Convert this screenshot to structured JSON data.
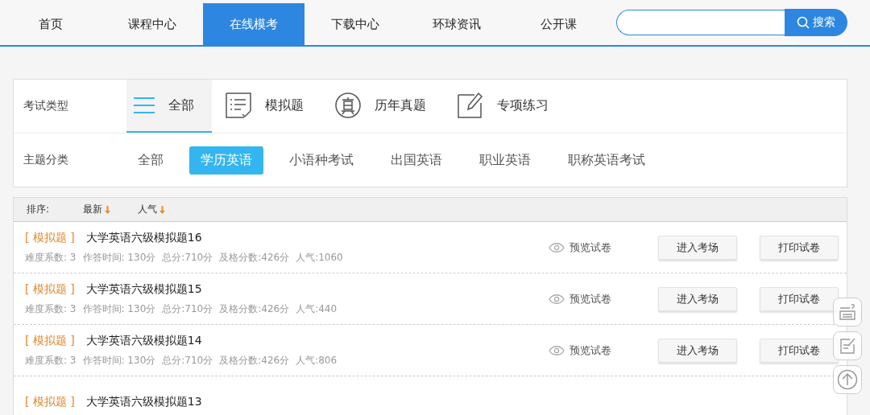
{
  "nav": {
    "items": [
      {
        "label": "首页",
        "selected": false
      },
      {
        "label": "课程中心",
        "selected": false
      },
      {
        "label": "在线模考",
        "selected": true
      },
      {
        "label": "下载中心",
        "selected": false
      },
      {
        "label": "环球资讯",
        "selected": false
      },
      {
        "label": "公开课",
        "selected": false
      }
    ],
    "search": {
      "button": "搜索"
    }
  },
  "exam_types": {
    "label": "考试类型",
    "items": [
      {
        "kind": "all",
        "label": "全部",
        "selected": true
      },
      {
        "kind": "mock",
        "label": "模拟题",
        "selected": false
      },
      {
        "kind": "past",
        "label": "历年真题",
        "selected": false
      },
      {
        "kind": "practice",
        "label": "专项练习",
        "selected": false
      }
    ]
  },
  "topics": {
    "label": "主题分类",
    "items": [
      {
        "label": "全部",
        "selected": false
      },
      {
        "label": "学历英语",
        "selected": true
      },
      {
        "label": "小语种考试",
        "selected": false
      },
      {
        "label": "出国英语",
        "selected": false
      },
      {
        "label": "职业英语",
        "selected": false
      },
      {
        "label": "职称英语考试",
        "selected": false
      }
    ]
  },
  "sort": {
    "label": "排序:",
    "options": [
      "最新",
      "人气"
    ]
  },
  "papers": [
    {
      "tag": "[ 模拟题 ]",
      "title": "大学英语六级模拟题16",
      "meta": [
        "难度系数: 3",
        "作答时间: 130分",
        "总分:710分",
        "及格分数:426分",
        "人气:1060"
      ],
      "preview": "预览试卷",
      "enter": "进入考场",
      "print": "打印试卷"
    },
    {
      "tag": "[ 模拟题 ]",
      "title": "大学英语六级模拟题15",
      "meta": [
        "难度系数: 3",
        "作答时间: 130分",
        "总分:710分",
        "及格分数:426分",
        "人气:440"
      ],
      "preview": "预览试卷",
      "enter": "进入考场",
      "print": "打印试卷"
    },
    {
      "tag": "[ 模拟题 ]",
      "title": "大学英语六级模拟题14",
      "meta": [
        "难度系数: 3",
        "作答时间: 130分",
        "总分:710分",
        "及格分数:426分",
        "人气:806"
      ],
      "preview": "预览试卷",
      "enter": "进入考场",
      "print": "打印试卷"
    },
    {
      "tag": "[ 模拟题 ]",
      "title": "大学英语六级模拟题13"
    }
  ]
}
